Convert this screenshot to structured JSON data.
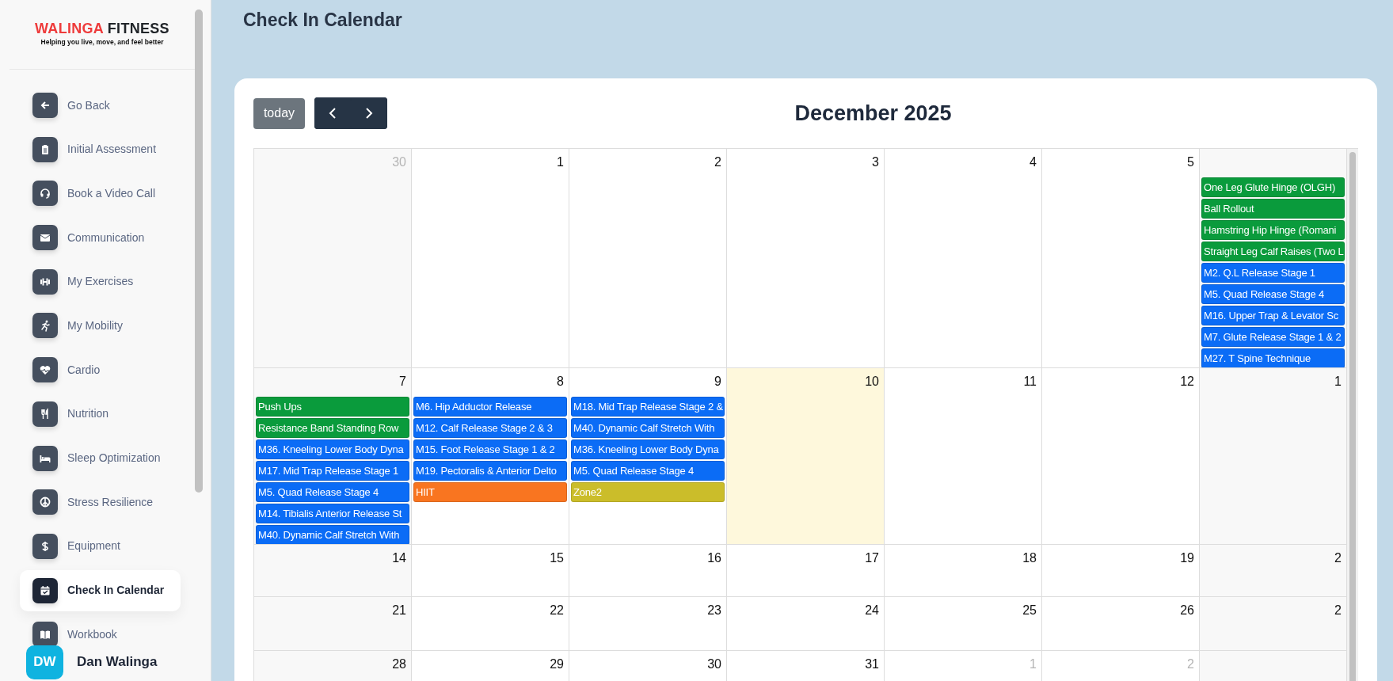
{
  "sidebar": {
    "logo": {
      "highlight": "WALINGA",
      "rest": "FITNESS",
      "tagline": "Helping you live, move, and feel better"
    },
    "items": [
      {
        "label": "Go Back",
        "selected": false
      },
      {
        "label": "Initial Assessment",
        "selected": false
      },
      {
        "label": "Book a Video Call",
        "selected": false
      },
      {
        "label": "Communication",
        "selected": false
      },
      {
        "label": "My Exercises",
        "selected": false
      },
      {
        "label": "My Mobility",
        "selected": false
      },
      {
        "label": "Cardio",
        "selected": false
      },
      {
        "label": "Nutrition",
        "selected": false
      },
      {
        "label": "Sleep Optimization",
        "selected": false
      },
      {
        "label": "Stress Resilience",
        "selected": false
      },
      {
        "label": "Equipment",
        "selected": false
      },
      {
        "label": "Check In Calendar",
        "selected": true
      },
      {
        "label": "Workbook",
        "selected": false
      }
    ],
    "user": {
      "initials": "DW",
      "name": "Dan Walinga"
    }
  },
  "page_title": "Check In Calendar",
  "calendar": {
    "today_button": "today",
    "title": "December 2025",
    "weeks": [
      {
        "days": [
          {
            "day": "30",
            "other_month": true,
            "today": false
          },
          {
            "day": "1",
            "other_month": false,
            "today": false
          },
          {
            "day": "2",
            "other_month": false,
            "today": false
          },
          {
            "day": "3",
            "other_month": false,
            "today": false
          },
          {
            "day": "4",
            "other_month": false,
            "today": false
          },
          {
            "day": "5",
            "other_month": false,
            "today": false
          },
          {
            "today": false,
            "events": [
              {
                "title": "One Leg Glute Hinge (OLGH)",
                "color": "#0a9b3c"
              },
              {
                "title": "Ball Rollout",
                "color": "#0a9b3c"
              },
              {
                "title": "Hamstring Hip Hinge (Romani",
                "color": "#0a9b3c"
              },
              {
                "title": "Straight Leg Calf Raises (Two L",
                "color": "#0a9b3c"
              },
              {
                "title": "M2. Q.L Release Stage 1",
                "color": "#0b6cf6"
              },
              {
                "title": "M5. Quad Release Stage 4",
                "color": "#0b6cf6"
              },
              {
                "title": "M16. Upper Trap & Levator Sc",
                "color": "#0b6cf6"
              },
              {
                "title": "M7. Glute Release Stage 1 & 2",
                "color": "#0b6cf6"
              },
              {
                "title": "M27. T Spine Technique",
                "color": "#0b6cf6"
              }
            ]
          }
        ]
      },
      {
        "days": [
          {
            "day": "7",
            "other_month": false,
            "today": false,
            "events": [
              {
                "title": "Push Ups",
                "color": "#0a9b3c"
              },
              {
                "title": "Resistance Band Standing Row",
                "color": "#0a9b3c"
              },
              {
                "title": "M36. Kneeling Lower Body Dyna",
                "color": "#0b6cf6"
              },
              {
                "title": "M17. Mid Trap Release Stage 1",
                "color": "#0b6cf6"
              },
              {
                "title": "M5. Quad Release Stage 4",
                "color": "#0b6cf6"
              },
              {
                "title": "M14. Tibialis Anterior Release St",
                "color": "#0b6cf6"
              },
              {
                "title": "M40. Dynamic Calf Stretch With",
                "color": "#0b6cf6"
              }
            ]
          },
          {
            "day": "8",
            "other_month": false,
            "today": false,
            "events": [
              {
                "title": "M6. Hip Adductor Release",
                "color": "#0b6cf6"
              },
              {
                "title": "M12. Calf Release Stage 2 & 3",
                "color": "#0b6cf6"
              },
              {
                "title": "M15. Foot Release Stage 1 & 2",
                "color": "#0b6cf6"
              },
              {
                "title": "M19. Pectoralis & Anterior Delto",
                "color": "#0b6cf6"
              },
              {
                "title": "HIIT",
                "color": "#f97520"
              }
            ]
          },
          {
            "day": "9",
            "other_month": false,
            "today": false,
            "events": [
              {
                "title": "M18. Mid Trap Release Stage 2 &",
                "color": "#0b6cf6"
              },
              {
                "title": "M40. Dynamic Calf Stretch With",
                "color": "#0b6cf6"
              },
              {
                "title": "M36. Kneeling Lower Body Dyna",
                "color": "#0b6cf6"
              },
              {
                "title": "M5. Quad Release Stage 4",
                "color": "#0b6cf6"
              },
              {
                "title": "Zone2",
                "color": "#cbbd2a"
              }
            ]
          },
          {
            "day": "10",
            "other_month": false,
            "today": true
          },
          {
            "day": "11",
            "other_month": false,
            "today": false
          },
          {
            "day": "12",
            "other_month": false,
            "today": false
          },
          {
            "day": "1",
            "other_month": false,
            "today": false
          }
        ]
      },
      {
        "days": [
          {
            "day": "14",
            "other_month": false,
            "today": false
          },
          {
            "day": "15",
            "other_month": false,
            "today": false
          },
          {
            "day": "16",
            "other_month": false,
            "today": false
          },
          {
            "day": "17",
            "other_month": false,
            "today": false
          },
          {
            "day": "18",
            "other_month": false,
            "today": false
          },
          {
            "day": "19",
            "other_month": false,
            "today": false
          },
          {
            "day": "2",
            "other_month": false,
            "today": false
          }
        ]
      },
      {
        "days": [
          {
            "day": "21",
            "other_month": false,
            "today": false
          },
          {
            "day": "22",
            "other_month": false,
            "today": false
          },
          {
            "day": "23",
            "other_month": false,
            "today": false
          },
          {
            "day": "24",
            "other_month": false,
            "today": false
          },
          {
            "day": "25",
            "other_month": false,
            "today": false
          },
          {
            "day": "26",
            "other_month": false,
            "today": false
          },
          {
            "day": "2",
            "other_month": false,
            "today": false
          }
        ]
      },
      {
        "days": [
          {
            "day": "28",
            "other_month": false,
            "today": false
          },
          {
            "day": "29",
            "other_month": false,
            "today": false
          },
          {
            "day": "30",
            "other_month": false,
            "today": false
          },
          {
            "day": "31",
            "other_month": false,
            "today": false
          },
          {
            "day": "1",
            "other_month": true,
            "today": false
          },
          {
            "day": "2",
            "other_month": true,
            "today": false
          },
          {
            "today": false
          }
        ]
      }
    ]
  }
}
